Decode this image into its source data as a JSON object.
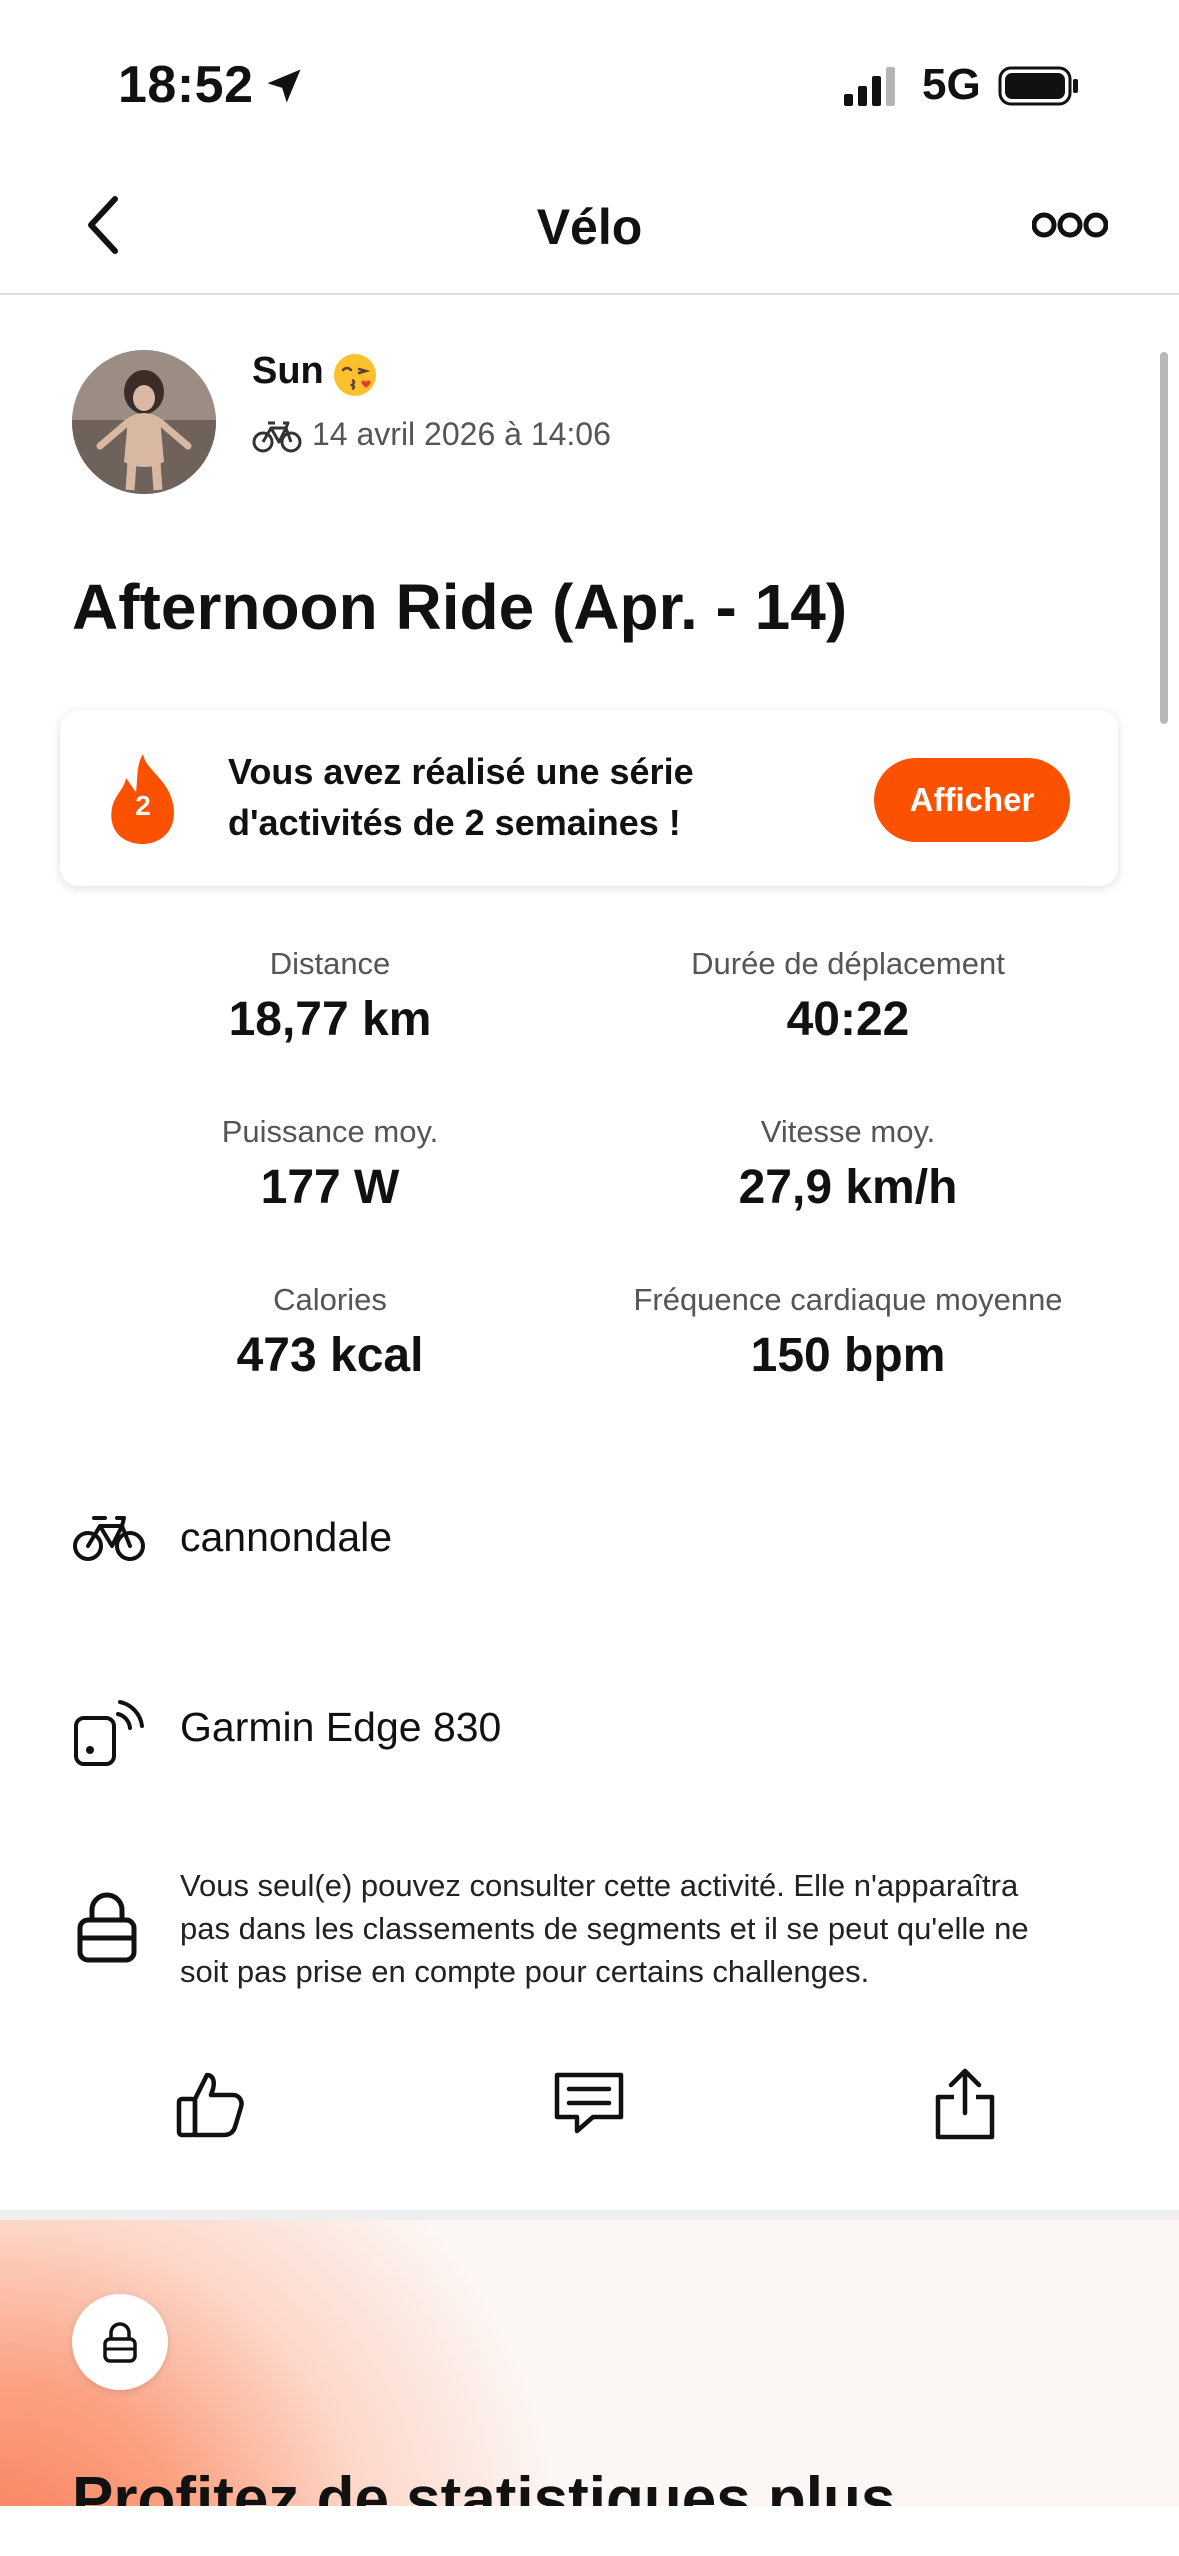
{
  "status_bar": {
    "time": "18:52",
    "network": "5G"
  },
  "nav": {
    "title": "Vélo"
  },
  "athlete": {
    "name": "Sun",
    "emoji": "😘",
    "date": "14 avril 2026 à 14:06"
  },
  "activity": {
    "title": "Afternoon Ride (Apr. - 14)"
  },
  "streak": {
    "count": "2",
    "line1": "Vous avez réalisé une série",
    "line2": "d'activités de 2 semaines !",
    "button": "Afficher"
  },
  "stats": [
    {
      "label": "Distance",
      "value": "18,77 km"
    },
    {
      "label": "Durée de déplacement",
      "value": "40:22"
    },
    {
      "label": "Puissance moy.",
      "value": "177 W"
    },
    {
      "label": "Vitesse moy.",
      "value": "27,9 km/h"
    },
    {
      "label": "Calories",
      "value": "473 kcal"
    },
    {
      "label": "Fréquence cardiaque moyenne",
      "value": "150 bpm"
    }
  ],
  "gear": {
    "bike": "cannondale",
    "device": "Garmin Edge 830"
  },
  "privacy": {
    "line1": "Vous seul(e) pouvez consulter cette activité. Elle n'apparaîtra",
    "line2": "pas dans les classements de segments et il se peut qu'elle ne",
    "line3": "soit pas prise en compte pour certains challenges."
  },
  "promo": {
    "title": "Profitez de statistiques plus"
  },
  "colors": {
    "accent": "#fc5200",
    "text": "#111111",
    "muted": "#555555"
  },
  "icons": {
    "back": "chevron-left-icon",
    "more": "more-icon",
    "bike": "bike-icon",
    "device": "device-icon",
    "lock": "lock-icon",
    "kudos": "thumbs-up-icon",
    "comment": "comment-icon",
    "share": "share-icon",
    "streak": "flame-icon"
  }
}
